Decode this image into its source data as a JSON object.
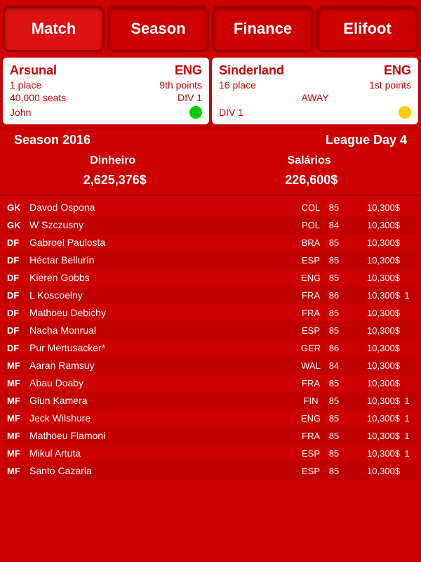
{
  "nav": {
    "tabs": [
      "Match",
      "Season",
      "Finance",
      "Elifoot"
    ]
  },
  "team_home": {
    "name": "Arsunal",
    "country": "ENG",
    "place": "1 place",
    "points": "9th points",
    "seats": "40,000 seats",
    "division": "DIV 1",
    "manager": "John",
    "status_color": "green"
  },
  "team_away": {
    "name": "Sinderland",
    "country": "ENG",
    "place": "16 place",
    "points": "1st points",
    "location": "AWAY",
    "division": "DIV 1",
    "status_color": "yellow"
  },
  "season": {
    "label": "Season 2016",
    "league_day": "League Day 4"
  },
  "finance": {
    "dinheiro_label": "Dinheiro",
    "salarios_label": "Salários",
    "dinheiro_value": "2,625,376$",
    "salarios_value": "226,600$"
  },
  "players": [
    {
      "pos": "GK",
      "name": "Davod Ospona",
      "nat": "COL",
      "rating": 85,
      "salary": "10,300$",
      "flag": ""
    },
    {
      "pos": "GK",
      "name": "W Szczusny",
      "nat": "POL",
      "rating": 84,
      "salary": "10,300$",
      "flag": ""
    },
    {
      "pos": "DF",
      "name": "Gabroel Paulosta",
      "nat": "BRA",
      "rating": 85,
      "salary": "10,300$",
      "flag": ""
    },
    {
      "pos": "DF",
      "name": "Héctar Bellurín",
      "nat": "ESP",
      "rating": 85,
      "salary": "10,300$",
      "flag": ""
    },
    {
      "pos": "DF",
      "name": "Kieren Gobbs",
      "nat": "ENG",
      "rating": 85,
      "salary": "10,300$",
      "flag": ""
    },
    {
      "pos": "DF",
      "name": "L Koscoelny",
      "nat": "FRA",
      "rating": 86,
      "salary": "10,300$",
      "flag": "1"
    },
    {
      "pos": "DF",
      "name": "Mathoeu Debichy",
      "nat": "FRA",
      "rating": 85,
      "salary": "10,300$",
      "flag": ""
    },
    {
      "pos": "DF",
      "name": "Nacha Monrual",
      "nat": "ESP",
      "rating": 85,
      "salary": "10,300$",
      "flag": ""
    },
    {
      "pos": "DF",
      "name": "Pur Mertusacker*",
      "nat": "GER",
      "rating": 86,
      "salary": "10,300$",
      "flag": ""
    },
    {
      "pos": "MF",
      "name": "Aaran Ramsuy",
      "nat": "WAL",
      "rating": 84,
      "salary": "10,300$",
      "flag": ""
    },
    {
      "pos": "MF",
      "name": "Abau Doaby",
      "nat": "FRA",
      "rating": 85,
      "salary": "10,300$",
      "flag": ""
    },
    {
      "pos": "MF",
      "name": "Glun Kamera",
      "nat": "FIN",
      "rating": 85,
      "salary": "10,300$",
      "flag": "1"
    },
    {
      "pos": "MF",
      "name": "Jeck Wilshure",
      "nat": "ENG",
      "rating": 85,
      "salary": "10,300$",
      "flag": "1"
    },
    {
      "pos": "MF",
      "name": "Mathoeu Flamoni",
      "nat": "FRA",
      "rating": 85,
      "salary": "10,300$",
      "flag": "1"
    },
    {
      "pos": "MF",
      "name": "Mikul Artuta",
      "nat": "ESP",
      "rating": 85,
      "salary": "10,300$",
      "flag": "1"
    },
    {
      "pos": "MF",
      "name": "Santo Cazarla",
      "nat": "ESP",
      "rating": 85,
      "salary": "10,300$",
      "flag": ""
    }
  ]
}
